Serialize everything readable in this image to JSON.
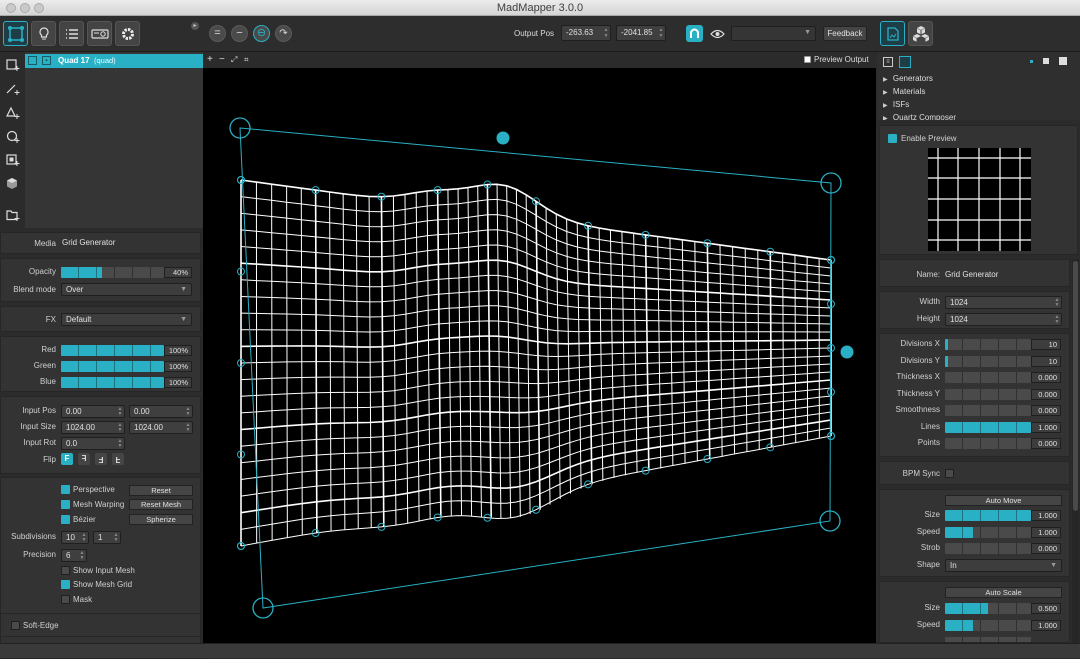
{
  "window": {
    "title": "MadMapper 3.0.0"
  },
  "toolbar": {
    "output_pos_label": "Output Pos",
    "output_pos_x": "-263.63",
    "output_pos_y": "-2041.85",
    "feedback_label": "Feedback",
    "accent": "#2ab0c4"
  },
  "surface_list": {
    "items": [
      {
        "name": "Quad 17",
        "type": "(quad)"
      }
    ]
  },
  "canvas_bar": {
    "preview_output_label": "Preview Output"
  },
  "media": {
    "label": "Media",
    "value": "Grid Generator"
  },
  "opacity": {
    "label": "Opacity",
    "value": "40%",
    "fraction": 0.4
  },
  "blend_mode": {
    "label": "Blend mode",
    "value": "Over"
  },
  "fx": {
    "label": "FX",
    "value": "Default"
  },
  "colors": [
    {
      "label": "Red",
      "value": "100%",
      "fraction": 1.0
    },
    {
      "label": "Green",
      "value": "100%",
      "fraction": 1.0
    },
    {
      "label": "Blue",
      "value": "100%",
      "fraction": 1.0
    }
  ],
  "input": {
    "pos_label": "Input Pos",
    "pos_x": "0.00",
    "pos_y": "0.00",
    "size_label": "Input Size",
    "size_x": "1024.00",
    "size_y": "1024.00",
    "rot_label": "Input Rot",
    "rot": "0.0",
    "flip_label": "Flip",
    "flip_options": [
      "F",
      "Ⅎ",
      "ƎL",
      "Ⅎ"
    ]
  },
  "mesh": {
    "perspective_label": "Perspective",
    "reset_label": "Reset",
    "mesh_warping_label": "Mesh Warping",
    "reset_mesh_label": "Reset Mesh",
    "bezier_label": "Bézier",
    "spherize_label": "Spherize",
    "subdivisions_label": "Subdivisions",
    "subdiv_x": "10",
    "subdiv_y": "1",
    "precision_label": "Precision",
    "precision": "6",
    "show_input_mesh_label": "Show Input Mesh",
    "show_mesh_grid_label": "Show Mesh Grid",
    "mask_label": "Mask"
  },
  "soft_edge": {
    "label": "Soft-Edge"
  },
  "library": {
    "items": [
      "Generators",
      "Materials",
      "ISFs",
      "Quartz Composer"
    ]
  },
  "preview": {
    "enable_label": "Enable Preview"
  },
  "generator": {
    "name_label": "Name:",
    "name": "Grid Generator",
    "width_label": "Width",
    "width": "1024",
    "height_label": "Height",
    "height": "1024",
    "params": [
      {
        "label": "Divisions X",
        "value": "10",
        "fraction": 0.04
      },
      {
        "label": "Divisions Y",
        "value": "10",
        "fraction": 0.04
      },
      {
        "label": "Thickness X",
        "value": "0.000",
        "fraction": 0.0
      },
      {
        "label": "Thickness Y",
        "value": "0.000",
        "fraction": 0.0
      },
      {
        "label": "Smoothness",
        "value": "0.000",
        "fraction": 0.0
      },
      {
        "label": "Lines",
        "value": "1.000",
        "fraction": 1.0
      },
      {
        "label": "Points",
        "value": "0.000",
        "fraction": 0.0
      }
    ],
    "bpm_sync_label": "BPM Sync",
    "auto_move": {
      "button": "Auto Move",
      "size_label": "Size",
      "size": "1.000",
      "size_fraction": 1.0,
      "speed_label": "Speed",
      "speed": "1.000",
      "speed_fraction": 0.33,
      "strob_label": "Strob",
      "strob": "0.000",
      "strob_fraction": 0.0,
      "shape_label": "Shape",
      "shape": "In"
    },
    "auto_scale": {
      "button": "Auto Scale",
      "size_label": "Size",
      "size": "0.500",
      "size_fraction": 0.5,
      "speed_label": "Speed",
      "speed": "1.000",
      "speed_fraction": 0.33
    }
  }
}
